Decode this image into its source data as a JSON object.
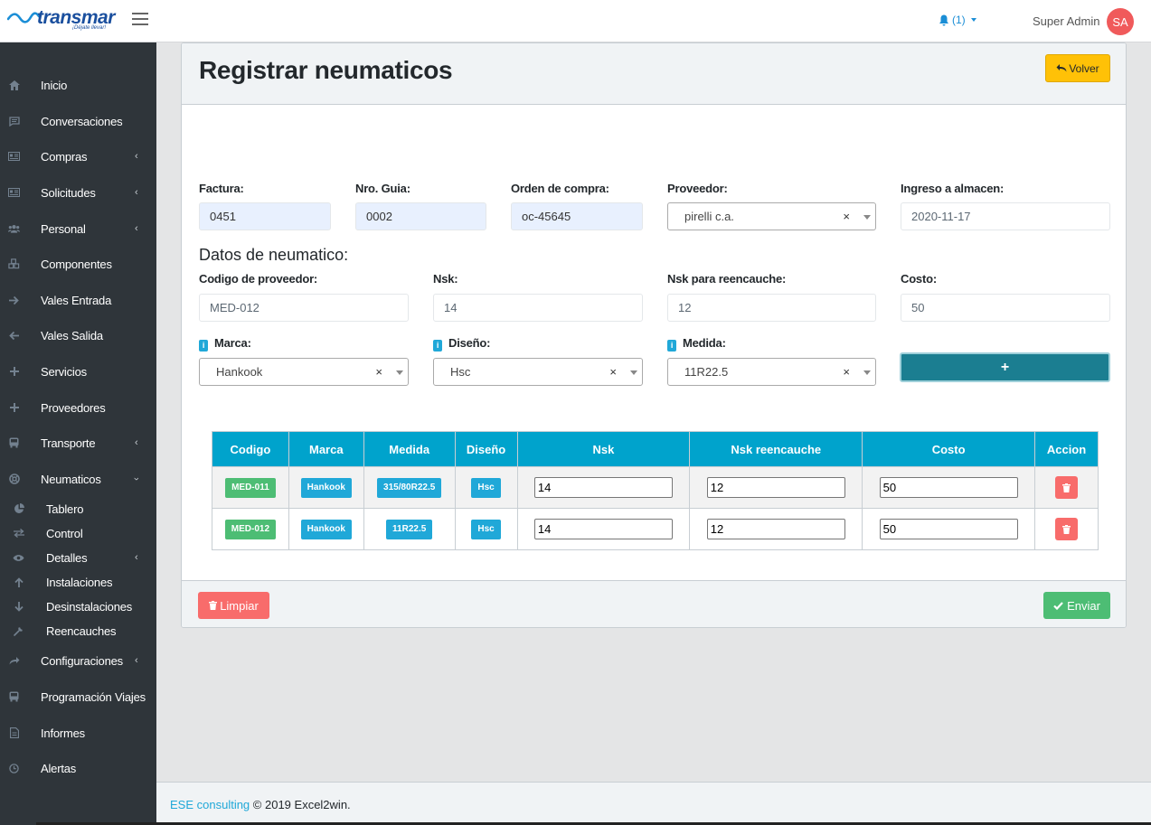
{
  "header": {
    "brand": "transmar",
    "brand_tagline": "¡Déjate llevar!",
    "notifications": "(1)",
    "user_name": "Super Admin",
    "user_initials": "SA"
  },
  "sidebar": {
    "items": [
      {
        "label": "Inicio",
        "icon": "home-icon"
      },
      {
        "label": "Conversaciones",
        "icon": "chat-icon"
      },
      {
        "label": "Compras",
        "icon": "id-card-icon"
      },
      {
        "label": "Solicitudes",
        "icon": "id-card-icon"
      },
      {
        "label": "Personal",
        "icon": "users-icon"
      },
      {
        "label": "Componentes",
        "icon": "cubes-icon"
      },
      {
        "label": "Vales Entrada",
        "icon": "arrow-right-icon"
      },
      {
        "label": "Vales Salida",
        "icon": "arrow-left-icon"
      },
      {
        "label": "Servicios",
        "icon": "plus-icon"
      },
      {
        "label": "Proveedores",
        "icon": "plus-icon"
      },
      {
        "label": "Transporte",
        "icon": "bus-icon"
      },
      {
        "label": "Neumaticos",
        "icon": "life-ring-icon"
      },
      {
        "label": "Tablero",
        "icon": "pie-chart-icon"
      },
      {
        "label": "Control",
        "icon": "exchange-icon"
      },
      {
        "label": "Detalles",
        "icon": "eye-icon"
      },
      {
        "label": "Instalaciones",
        "icon": "arrow-up-icon"
      },
      {
        "label": "Desinstalaciones",
        "icon": "arrow-down-icon"
      },
      {
        "label": "Reencauches",
        "icon": "wrench-icon"
      },
      {
        "label": "Configuraciones",
        "icon": "share-icon"
      },
      {
        "label": "Programación Viajes",
        "icon": "bus-icon"
      },
      {
        "label": "Informes",
        "icon": "file-icon"
      },
      {
        "label": "Alertas",
        "icon": "clock-icon"
      }
    ]
  },
  "page": {
    "title": "Registrar neumaticos",
    "back_label": "Volver"
  },
  "form": {
    "factura_label": "Factura:",
    "factura_value": "0451",
    "guia_label": "Nro. Guia:",
    "guia_value": "0002",
    "orden_label": "Orden de compra:",
    "orden_value": "oc-45645",
    "proveedor_label": "Proveedor:",
    "proveedor_value": "pirelli c.a.",
    "ingreso_label": "Ingreso a almacen:",
    "ingreso_value": "2020-11-17",
    "section_title": "Datos de neumatico:",
    "codigo_label": "Codigo de proveedor:",
    "codigo_value": "MED-012",
    "nsk_label": "Nsk:",
    "nsk_value": "14",
    "nskr_label": "Nsk para reencauche:",
    "nskr_value": "12",
    "costo_label": "Costo:",
    "costo_value": "50",
    "marca_label": "Marca:",
    "marca_value": "Hankook",
    "diseno_label": "Diseño:",
    "diseno_value": "Hsc",
    "medida_label": "Medida:",
    "medida_value": "11R22.5",
    "clear_symbol": "×",
    "add_symbol": "+"
  },
  "table": {
    "headers": [
      "Codigo",
      "Marca",
      "Medida",
      "Diseño",
      "Nsk",
      "Nsk reencauche",
      "Costo",
      "Accion"
    ],
    "rows": [
      {
        "codigo": "MED-011",
        "marca": "Hankook",
        "medida": "315/80R22.5",
        "diseno": "Hsc",
        "nsk": "14",
        "nskr": "12",
        "costo": "50"
      },
      {
        "codigo": "MED-012",
        "marca": "Hankook",
        "medida": "11R22.5",
        "diseno": "Hsc",
        "nsk": "14",
        "nskr": "12",
        "costo": "50"
      }
    ]
  },
  "footer_actions": {
    "clear_label": "Limpiar",
    "send_label": "Enviar"
  },
  "footer": {
    "link": "ESE consulting",
    "text": "© 2019 Excel2win."
  },
  "colors": {
    "sidebar": "#2f353a",
    "primary": "#00a3cc",
    "warning": "#ffc107",
    "danger": "#f86c6b",
    "success": "#4dbd74",
    "add_button": "#1b7e91"
  }
}
